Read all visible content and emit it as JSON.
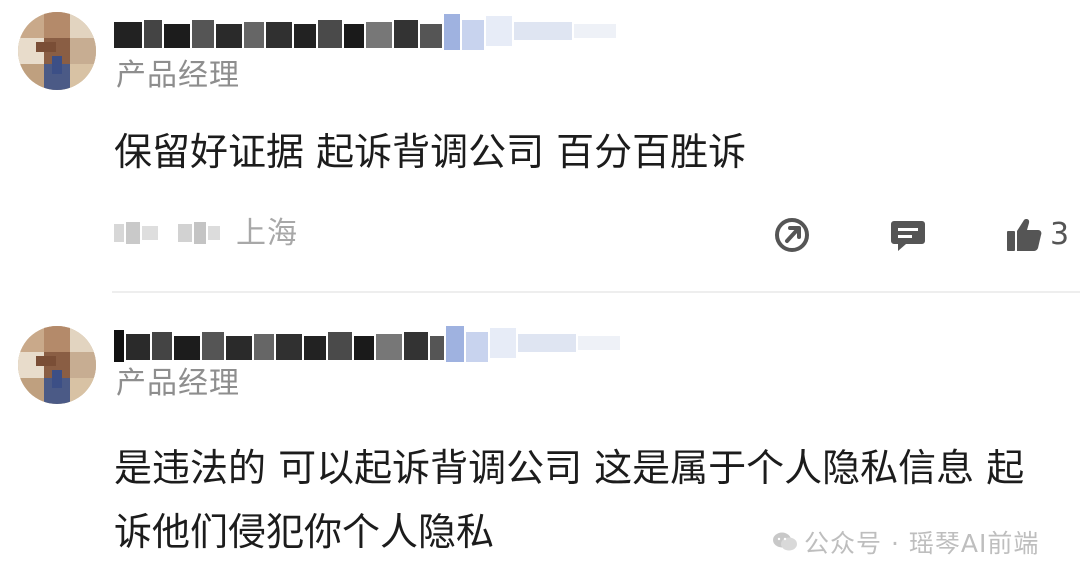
{
  "comments": [
    {
      "role": "产品经理",
      "content": "保留好证据 起诉背调公司  百分百胜诉",
      "location": "上海",
      "likes": "3"
    },
    {
      "role": "产品经理",
      "content": "是违法的  可以起诉背调公司  这是属于个人隐私信息  起诉他们侵犯你个人隐私"
    }
  ],
  "watermark": {
    "text": "公众号 · 瑶琴AI前端"
  },
  "icons": {
    "share": "share-icon",
    "reply": "comment-icon",
    "like": "thumbs-up-icon",
    "watermark": "wechat-icon"
  },
  "colors": {
    "text_primary": "#1c1c1c",
    "text_secondary": "#8e8e8e",
    "icon": "#555555",
    "divider": "#eeeeee"
  }
}
